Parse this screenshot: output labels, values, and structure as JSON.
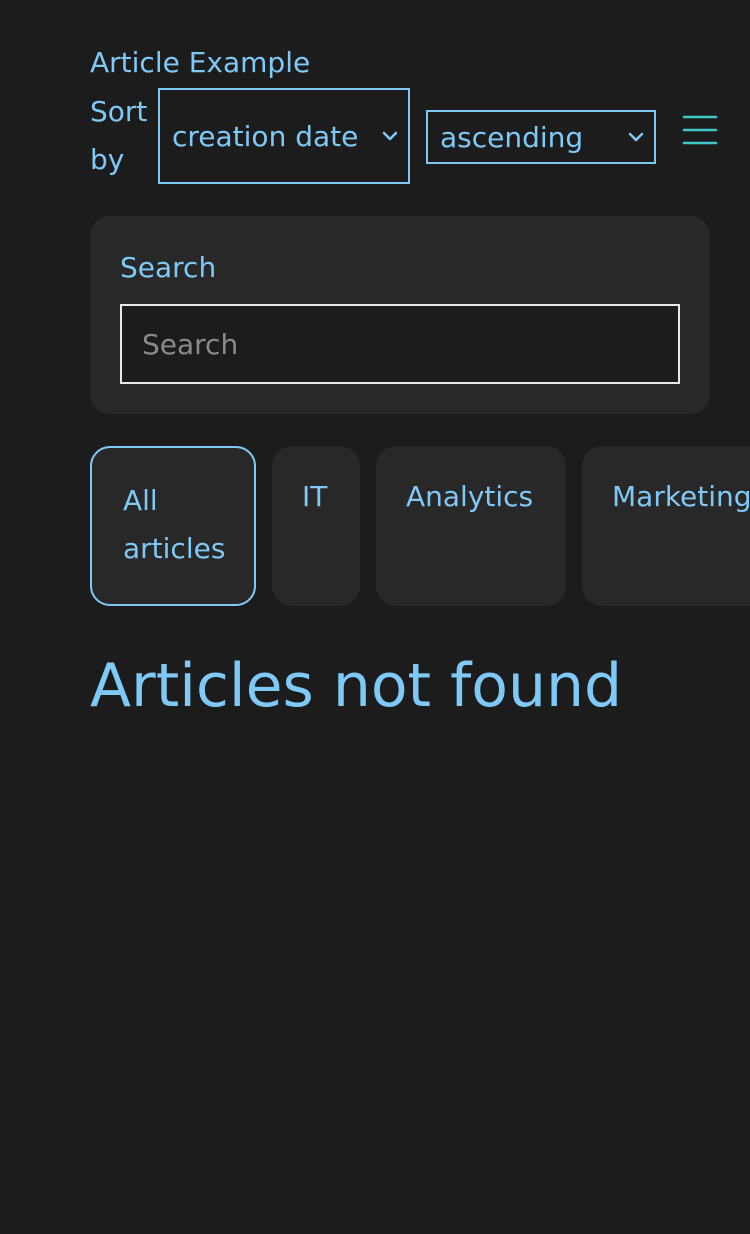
{
  "header": {
    "title": "Article Example",
    "sort_label": "Sort by",
    "sort_field": {
      "selected": "creation date"
    },
    "sort_order": {
      "selected": "ascending"
    },
    "menu_icon": "hamburger-menu-icon"
  },
  "search": {
    "label": "Search",
    "placeholder": "Search",
    "value": ""
  },
  "tabs": [
    {
      "label": "All articles",
      "active": true
    },
    {
      "label": "IT",
      "active": false
    },
    {
      "label": "Analytics",
      "active": false
    },
    {
      "label": "Marketing",
      "active": false
    }
  ],
  "main": {
    "empty_message": "Articles not found"
  },
  "colors": {
    "background": "#1c1c1c",
    "panel": "#282828",
    "accent": "#7fc9f7",
    "menu_icon": "#3fc7c7"
  }
}
